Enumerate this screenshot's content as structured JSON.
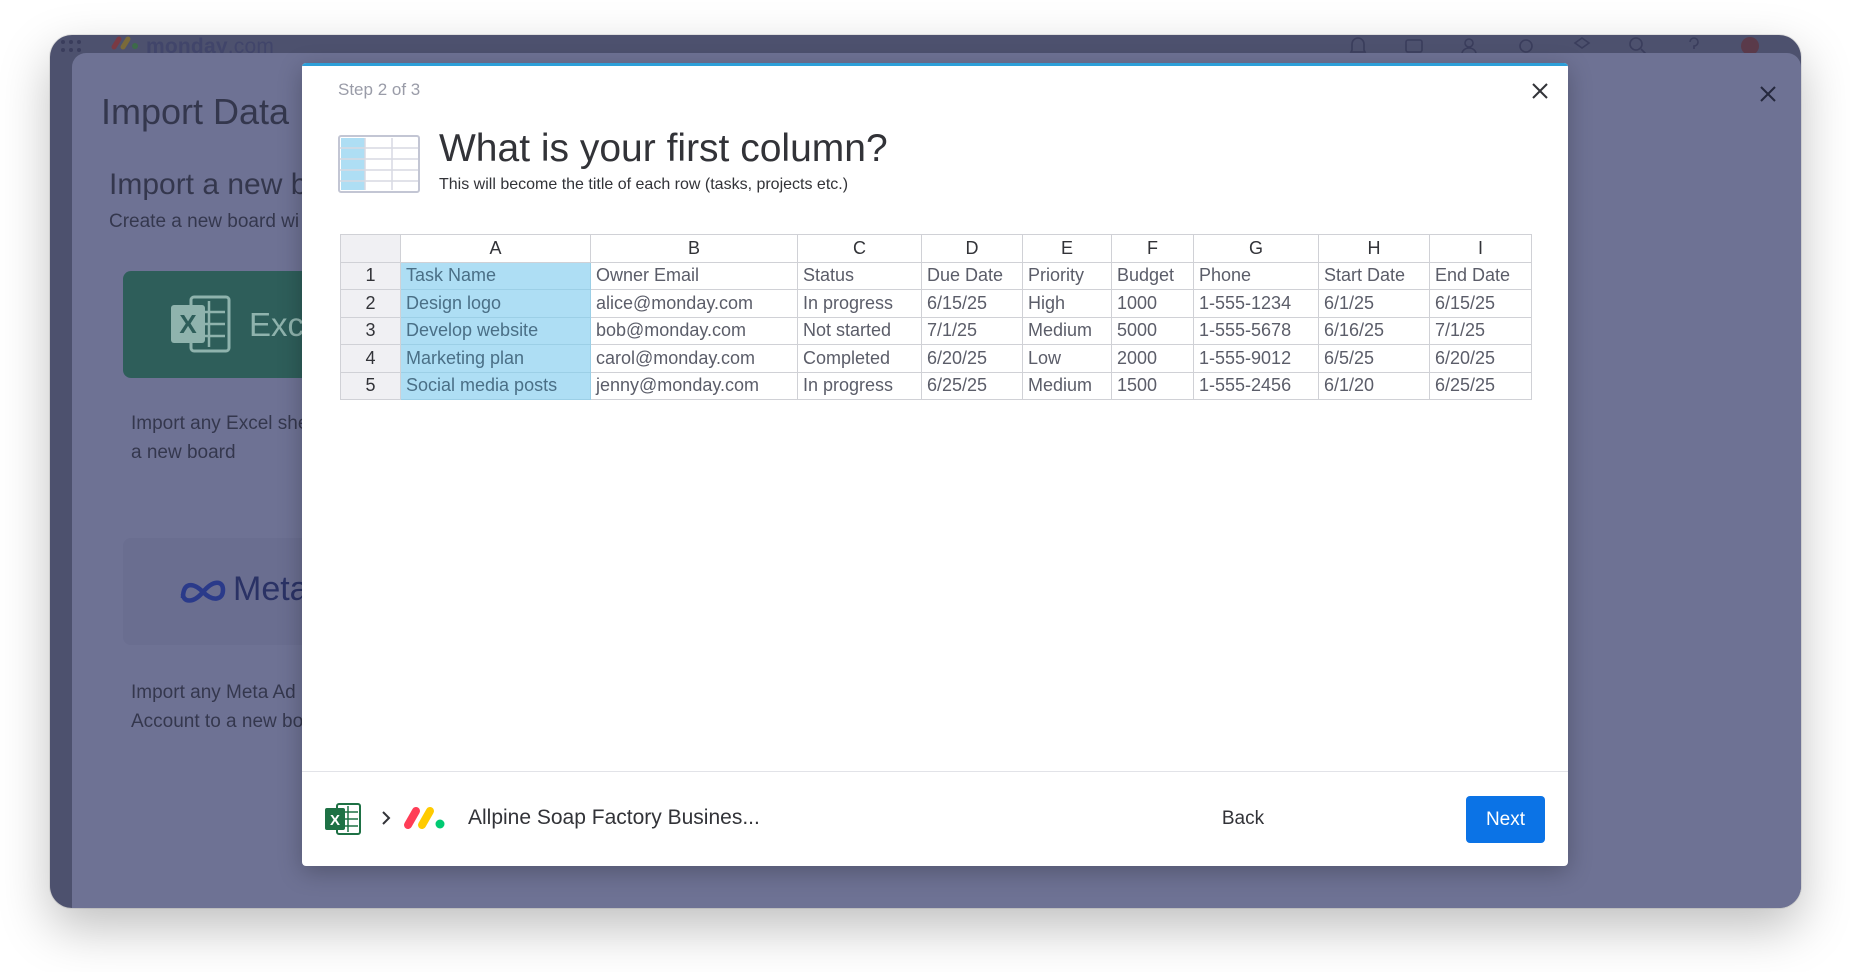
{
  "app": {
    "brand": "monday",
    "brand_tld": ".com",
    "top_icons": [
      "bell-icon",
      "inbox-icon",
      "invite-icon",
      "apps-icon",
      "integrations-icon",
      "search-icon",
      "help-icon",
      "avatar"
    ]
  },
  "background": {
    "title": "Import Data",
    "subtitle": "Import a new b",
    "description": "Create a new board wi",
    "excel_card_label": "Exce",
    "excel_text_line1": "Import any Excel she",
    "excel_text_line2": "a new board",
    "meta_card_label": "Meta",
    "meta_text_line1": "Import any Meta Ad",
    "meta_text_line2": "Account to a new bo"
  },
  "modal": {
    "step": "Step 2 of 3",
    "title": "What is your first column?",
    "subtitle": "This will become the title of each row (tasks, projects etc.)",
    "table": {
      "columns": [
        "A",
        "B",
        "C",
        "D",
        "E",
        "F",
        "G",
        "H",
        "I"
      ],
      "rows": [
        {
          "num": "1",
          "cells": [
            "Task Name",
            "Owner Email",
            "Status",
            "Due Date",
            "Priority",
            "Budget",
            "Phone",
            "Start Date",
            "End Date"
          ]
        },
        {
          "num": "2",
          "cells": [
            "Design logo",
            "alice@monday.com",
            "In progress",
            "6/15/25",
            "High",
            "1000",
            "1-555-1234",
            "6/1/25",
            "6/15/25"
          ]
        },
        {
          "num": "3",
          "cells": [
            "Develop website",
            "bob@monday.com",
            "Not started",
            "7/1/25",
            "Medium",
            "5000",
            "1-555-5678",
            "6/16/25",
            "7/1/25"
          ]
        },
        {
          "num": "4",
          "cells": [
            "Marketing plan",
            "carol@monday.com",
            "Completed",
            "6/20/25",
            "Low",
            "2000",
            "1-555-9012",
            "6/5/25",
            "6/20/25"
          ]
        },
        {
          "num": "5",
          "cells": [
            "Social media posts",
            "jenny@monday.com",
            "In progress",
            "6/25/25",
            "Medium",
            "1500",
            "1-555-2456",
            "6/1/20",
            "6/25/25"
          ]
        }
      ],
      "selected_column": "A"
    },
    "footer": {
      "board_name": "Allpine Soap Factory Busines...",
      "back_label": "Back",
      "next_label": "Next"
    }
  },
  "colors": {
    "accent": "#2d9fd8",
    "primary_button": "#0b73e6",
    "selected_column": "#aedef4",
    "overlay": "#6e7294"
  }
}
